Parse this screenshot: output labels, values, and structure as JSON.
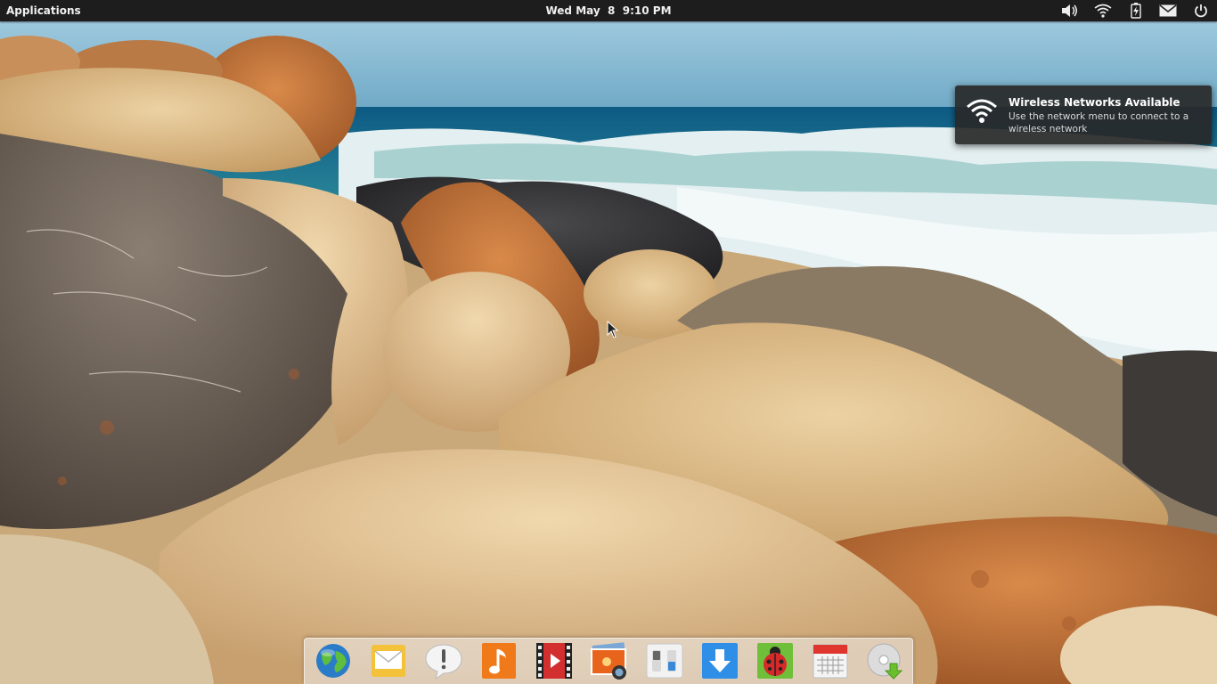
{
  "panel": {
    "applications_label": "Applications",
    "clock": "Wed May  8  9:10 PM",
    "indicators": [
      "volume-icon",
      "wifi-icon",
      "battery-icon",
      "mail-icon",
      "power-icon"
    ]
  },
  "notification": {
    "title": "Wireless Networks Available",
    "body": "Use the network menu to connect to a wireless network",
    "icon": "wifi-icon"
  },
  "dock": {
    "items": [
      {
        "name": "web-browser",
        "icon": "globe-icon"
      },
      {
        "name": "mail",
        "icon": "envelope-icon"
      },
      {
        "name": "messaging",
        "icon": "speech-bubble-icon"
      },
      {
        "name": "music",
        "icon": "music-note-icon"
      },
      {
        "name": "videos",
        "icon": "film-icon"
      },
      {
        "name": "photos",
        "icon": "photo-camera-icon"
      },
      {
        "name": "system-settings",
        "icon": "switches-icon"
      },
      {
        "name": "software-updates",
        "icon": "download-arrow-icon"
      },
      {
        "name": "bug-reporter",
        "icon": "ladybug-icon"
      },
      {
        "name": "calendar",
        "icon": "calendar-icon"
      },
      {
        "name": "disc-installer",
        "icon": "disc-icon"
      }
    ]
  },
  "colors": {
    "panel_bg": "#1d1d1d",
    "sky": "#7fb6cf",
    "sea": "#1f6f8f",
    "foam": "#e8f2f3",
    "sandstone": "#d9b482"
  }
}
